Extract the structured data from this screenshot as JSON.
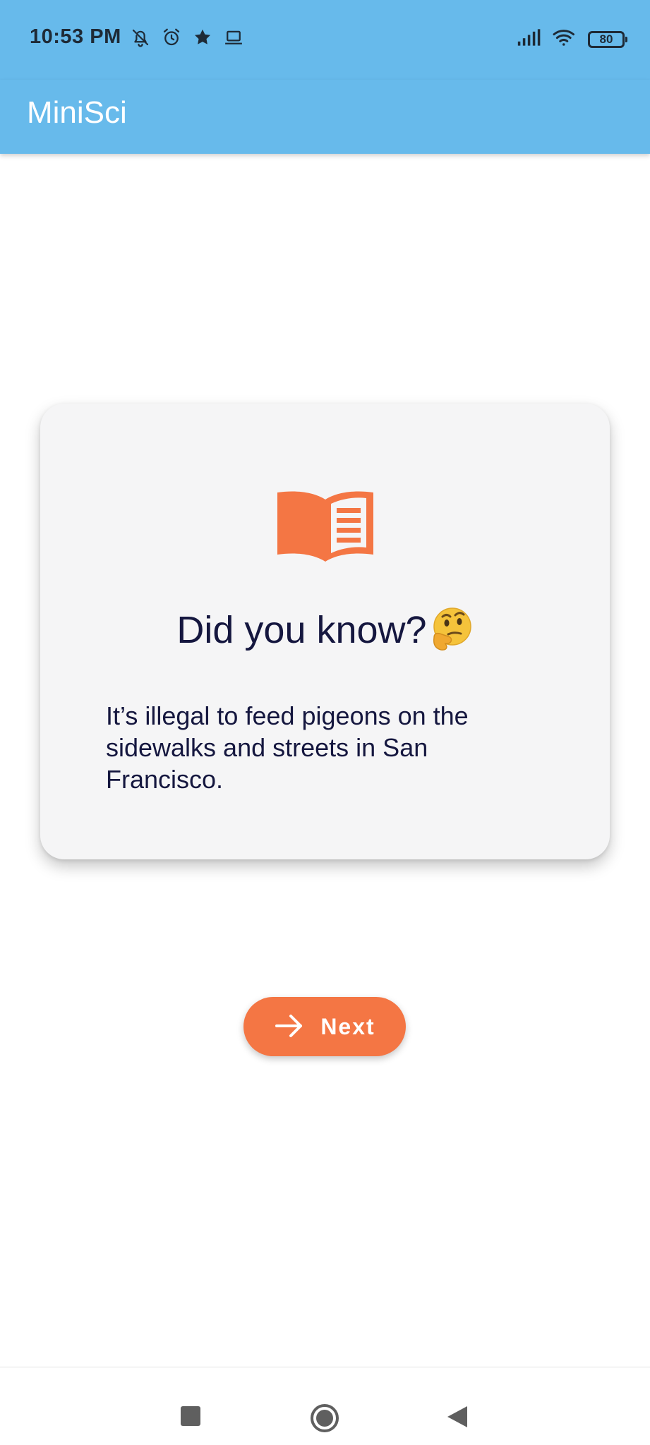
{
  "status_bar": {
    "time": "10:53 PM",
    "battery_level": "80",
    "left_icons": [
      "notifications-off-icon",
      "alarm-icon",
      "star-icon",
      "laptop-icon"
    ],
    "right_icons": [
      "signal-icon",
      "wifi-icon",
      "battery-icon"
    ]
  },
  "app_bar": {
    "title": "MiniSci",
    "background_color": "#67baeb"
  },
  "fact_card": {
    "icon": "open-book-icon",
    "icon_color": "#f47644",
    "title": "Did you know?",
    "title_emoji": "thinking-face-emoji",
    "body": "It’s illegal to feed pigeons on the sidewalks and streets in San Francisco."
  },
  "next_button": {
    "label": "Next",
    "icon": "arrow-right-icon",
    "background_color": "#f47644"
  },
  "nav_bar": {
    "buttons": [
      "recents-button",
      "home-button",
      "back-button"
    ]
  }
}
